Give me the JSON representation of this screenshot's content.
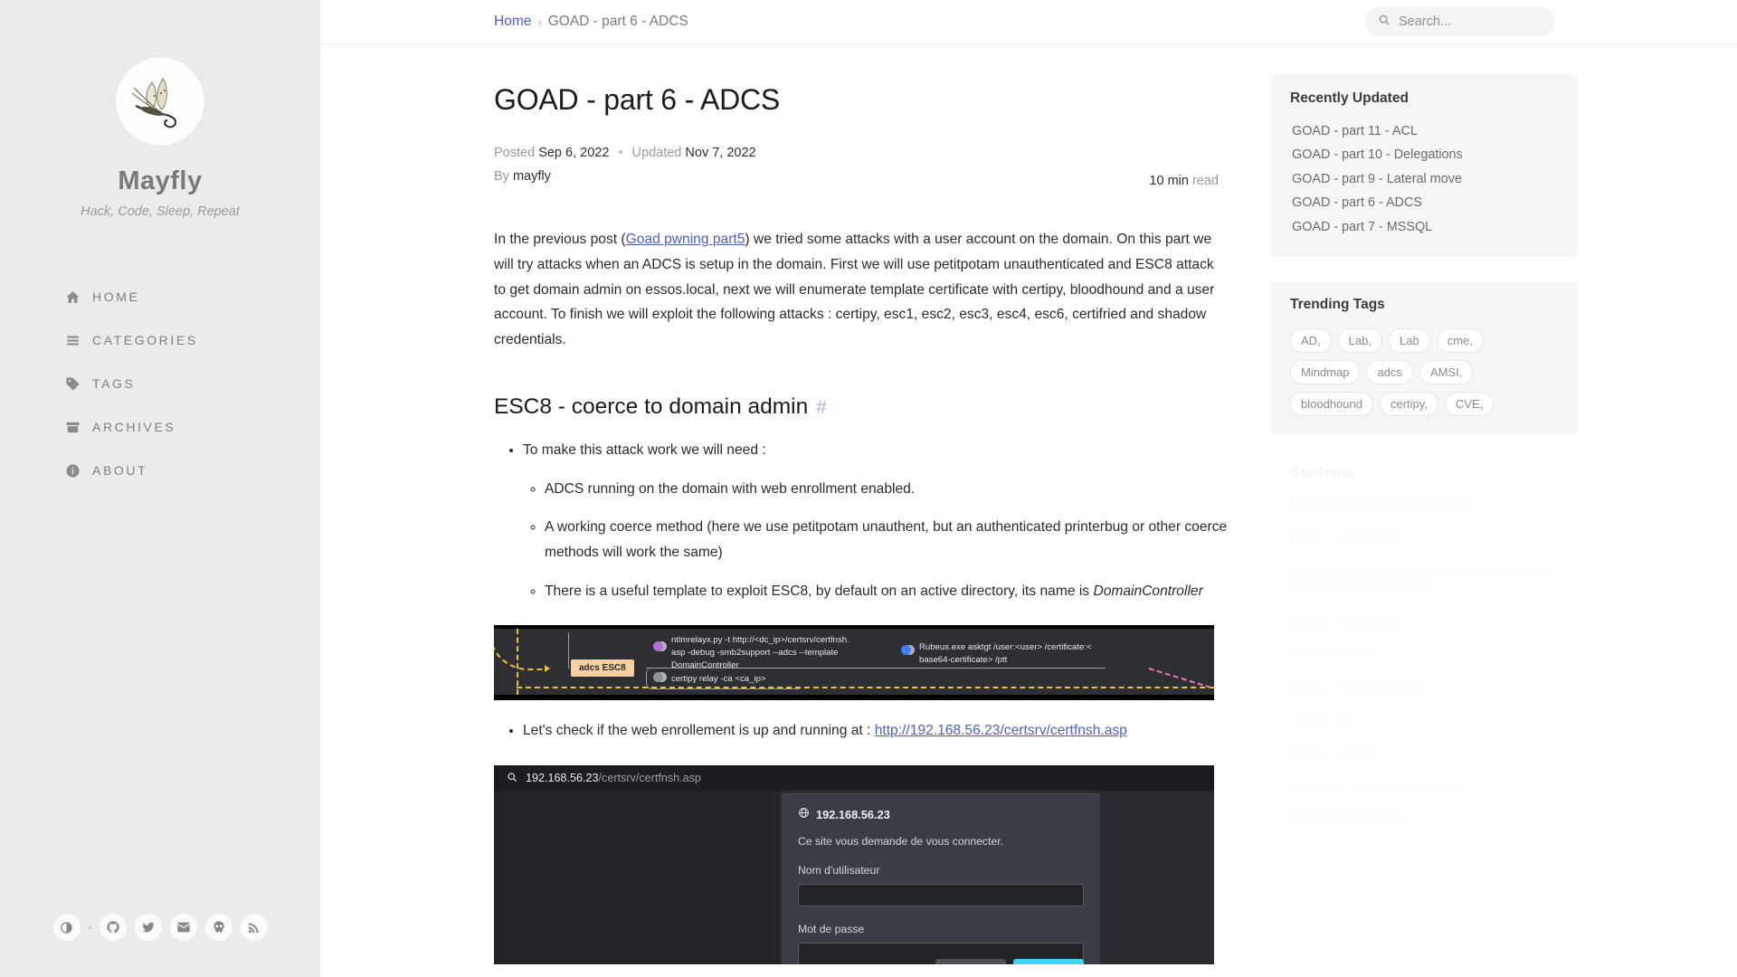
{
  "sidebar": {
    "avatar_alt": "mayfly-avatar",
    "site_title": "Mayfly",
    "tagline": "Hack, Code, Sleep, Repeat",
    "nav": [
      {
        "label": "HOME",
        "icon": "home-icon"
      },
      {
        "label": "CATEGORIES",
        "icon": "list-icon"
      },
      {
        "label": "TAGS",
        "icon": "tag-icon"
      },
      {
        "label": "ARCHIVES",
        "icon": "archive-icon"
      },
      {
        "label": "ABOUT",
        "icon": "info-icon"
      }
    ],
    "social": [
      {
        "name": "theme-toggle-icon",
        "glyph": "◐"
      },
      {
        "name": "github-icon",
        "glyph": "github"
      },
      {
        "name": "twitter-icon",
        "glyph": "twitter"
      },
      {
        "name": "email-icon",
        "glyph": "✉"
      },
      {
        "name": "hackthebox-skull-icon",
        "glyph": "skull"
      },
      {
        "name": "rss-icon",
        "glyph": "rss"
      }
    ]
  },
  "topbar": {
    "breadcrumb_home": "Home",
    "breadcrumb_sep": "›",
    "breadcrumb_current": "GOAD - part 6 - ADCS",
    "search_placeholder": "Search...",
    "search_value": ""
  },
  "post": {
    "title": "GOAD - part 6 - ADCS",
    "posted_label": "Posted",
    "posted_date": "Sep 6, 2022",
    "meta_sep": "•",
    "updated_label": "Updated",
    "updated_date": "Nov 7, 2022",
    "by_label": "By",
    "author": "mayfly",
    "read_time": "10 min",
    "read_label": "read",
    "intro_pre": "In the previous post (",
    "intro_link": "Goad pwning part5",
    "intro_post": ") we tried some attacks with a user account on the domain. On this part we will try attacks when an ADCS is setup in the domain. First we will use petitpotam unauthenticated and ESC8 attack to get domain admin on essos.local, next we will enumerate template certificate with certipy, bloodhound and a user account. To finish we will exploit the following attacks : certipy, esc1, esc2, esc3, esc4, esc6, certifried and shadow credentials.",
    "section_heading": "ESC8 - coerce to domain admin",
    "anchor_glyph": "#",
    "bullet_intro": "To make this attack work we will need :",
    "sub_bullets": [
      "ADCS running on the domain with web enrollment enabled.",
      "A working coerce method (here we use petitpotam unauthent, but an authenticated printerbug or other coerce methods will work the same)"
    ],
    "sub_bullet_3_pre": "There is a useful template to exploit ESC8, by default on an active directory, its name is ",
    "sub_bullet_3_em": "DomainController",
    "check_bullet_pre": "Let's check if the web enrollement is up and running at : ",
    "check_bullet_link": "http://192.168.56.23/certsrv/certfnsh.asp"
  },
  "diagram": {
    "node_label": "adcs ESC8",
    "cmd_ntlmrelayx": "ntlmrelayx.py -t http://<dc_ip>/certsrv/certfnsh.\nasp -debug -smb2support --adcs --template\nDomainController",
    "cmd_certipy": "certipy relay -ca <ca_ip>",
    "cmd_rubeus": "Rubeus.exe asktgt /user:<user> /certificate:<\nbase64-certificate> /ptt"
  },
  "browser": {
    "url_strong": "192.168.56.23",
    "url_dim": "/certsrv/certfnsh.asp",
    "search_icon": "search-icon",
    "globe_icon": "globe-icon",
    "dialog_host": "192.168.56.23",
    "dialog_desc": "Ce site vous demande de vous connecter.",
    "username_label": "Nom d'utilisateur",
    "username_value": "",
    "password_label": "Mot de passe",
    "password_value": ""
  },
  "aside": {
    "recently_updated_title": "Recently Updated",
    "recently_updated": [
      "GOAD - part 11 - ACL",
      "GOAD - part 10 - Delegations",
      "GOAD - part 9 - Lateral move",
      "GOAD - part 6 - ADCS",
      "GOAD - part 7 - MSSQL"
    ],
    "trending_tags_title": "Trending Tags",
    "trending_tags": [
      "AD,",
      "Lab,",
      "Lab",
      "cme,",
      "Mindmap",
      "adcs",
      "AMSI,",
      "bloodhound",
      "certipy,",
      "CVE,"
    ],
    "contents_title": "Contents",
    "contents": [
      "ESC8 - coerce to domain admin",
      "ESC8 - with certipy",
      "ADCS reconnaissance and enumeration (with certipy and bloodhound)",
      "ADCS - exploitation",
      "ADCS - ESC1",
      "ADCS - ESC2 & ESC3",
      "ADCS - ESC4",
      "ADCS - ESC6",
      "Certifried - CVE-2022–26923",
      "Shadow Credentials"
    ]
  },
  "colors": {
    "sidebar_bg": "#ebebeb",
    "link_blue": "#4b62c4",
    "node_orange": "#f7cfa0",
    "diagram_yellow": "#e8c23a",
    "diagram_pink": "#e679b8",
    "dialog_primary": "#3ed3f5"
  }
}
